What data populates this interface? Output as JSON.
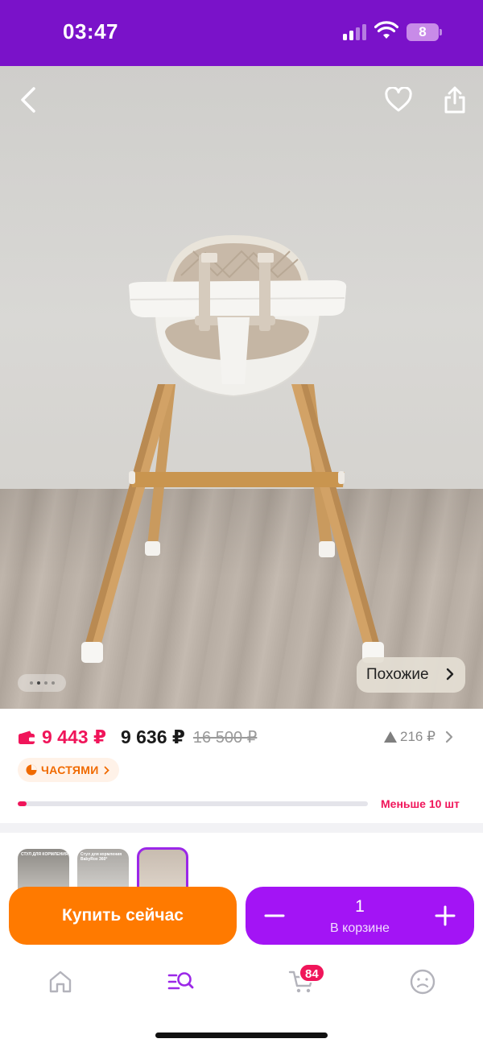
{
  "status_bar": {
    "time": "03:47",
    "battery": "8",
    "icons": [
      "signal-icon",
      "wifi-icon",
      "battery-icon"
    ]
  },
  "hero": {
    "image": "high-chair-photo",
    "carousel_index": 2,
    "carousel_total": 4,
    "similar_label": "Похожие",
    "icons": [
      "back-icon",
      "heart-icon",
      "share-icon"
    ]
  },
  "price": {
    "main": "9 443 ₽",
    "second": "9 636 ₽",
    "old": "16 500 ₽",
    "change": "216 ₽",
    "installments_label": "ЧАСТЯМИ",
    "stock_fraction": 0.025,
    "stock_text": "Меньше 10 шт"
  },
  "thumbnails": [
    {
      "caption": "СТУЛ ДЛЯ КОРМЛЕНИЯ"
    },
    {
      "caption": "Стул для кормления BabyRox 360°"
    },
    {
      "caption": ""
    }
  ],
  "actions": {
    "buy_now": "Купить сейчас",
    "quantity": "1",
    "in_cart": "В корзине"
  },
  "bottom_nav": {
    "cart_badge": "84",
    "items": [
      "home-icon",
      "catalog-search-icon",
      "cart-icon",
      "profile-icon"
    ]
  },
  "colors": {
    "status_bar": "#7a12c9",
    "price_accent": "#f0155a",
    "buy_button": "#ff7a00",
    "cart_button": "#a314f5",
    "active_nav": "#9b27e8"
  }
}
